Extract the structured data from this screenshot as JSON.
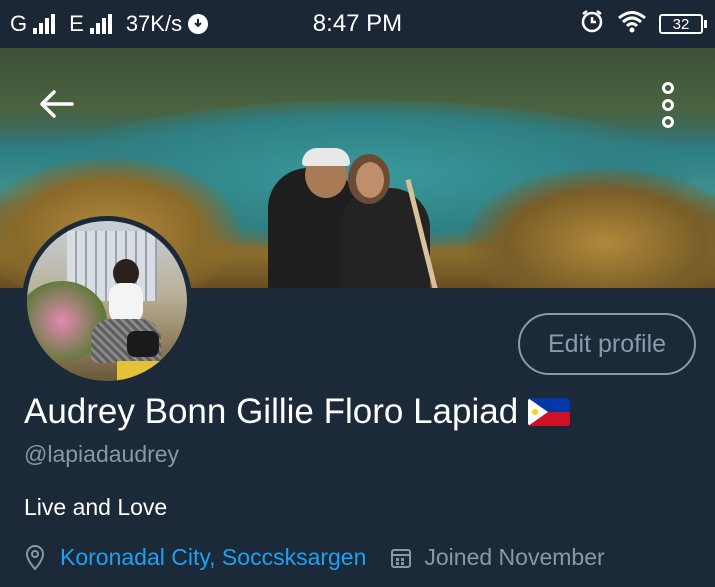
{
  "status_bar": {
    "carrier1": "G",
    "carrier2": "E",
    "speed": "37K/s",
    "time": "8:47 PM",
    "battery": "32",
    "icons": [
      "signal-icon",
      "download-icon",
      "alarm-icon",
      "wifi-icon",
      "battery-icon"
    ]
  },
  "header": {
    "back_icon": "back-arrow-icon",
    "more_icon": "more-vertical-icon"
  },
  "profile": {
    "edit_label": "Edit profile",
    "name": "Audrey Bonn Gillie Floro Lapiad",
    "flag": "philippines-flag-icon",
    "handle": "@lapiadaudrey",
    "bio": "Live and Love",
    "location": "Koronadal City, Soccsksargen",
    "joined": "Joined November"
  },
  "colors": {
    "background": "#1c2938",
    "link": "#1da1f2",
    "muted": "#8899a6"
  }
}
